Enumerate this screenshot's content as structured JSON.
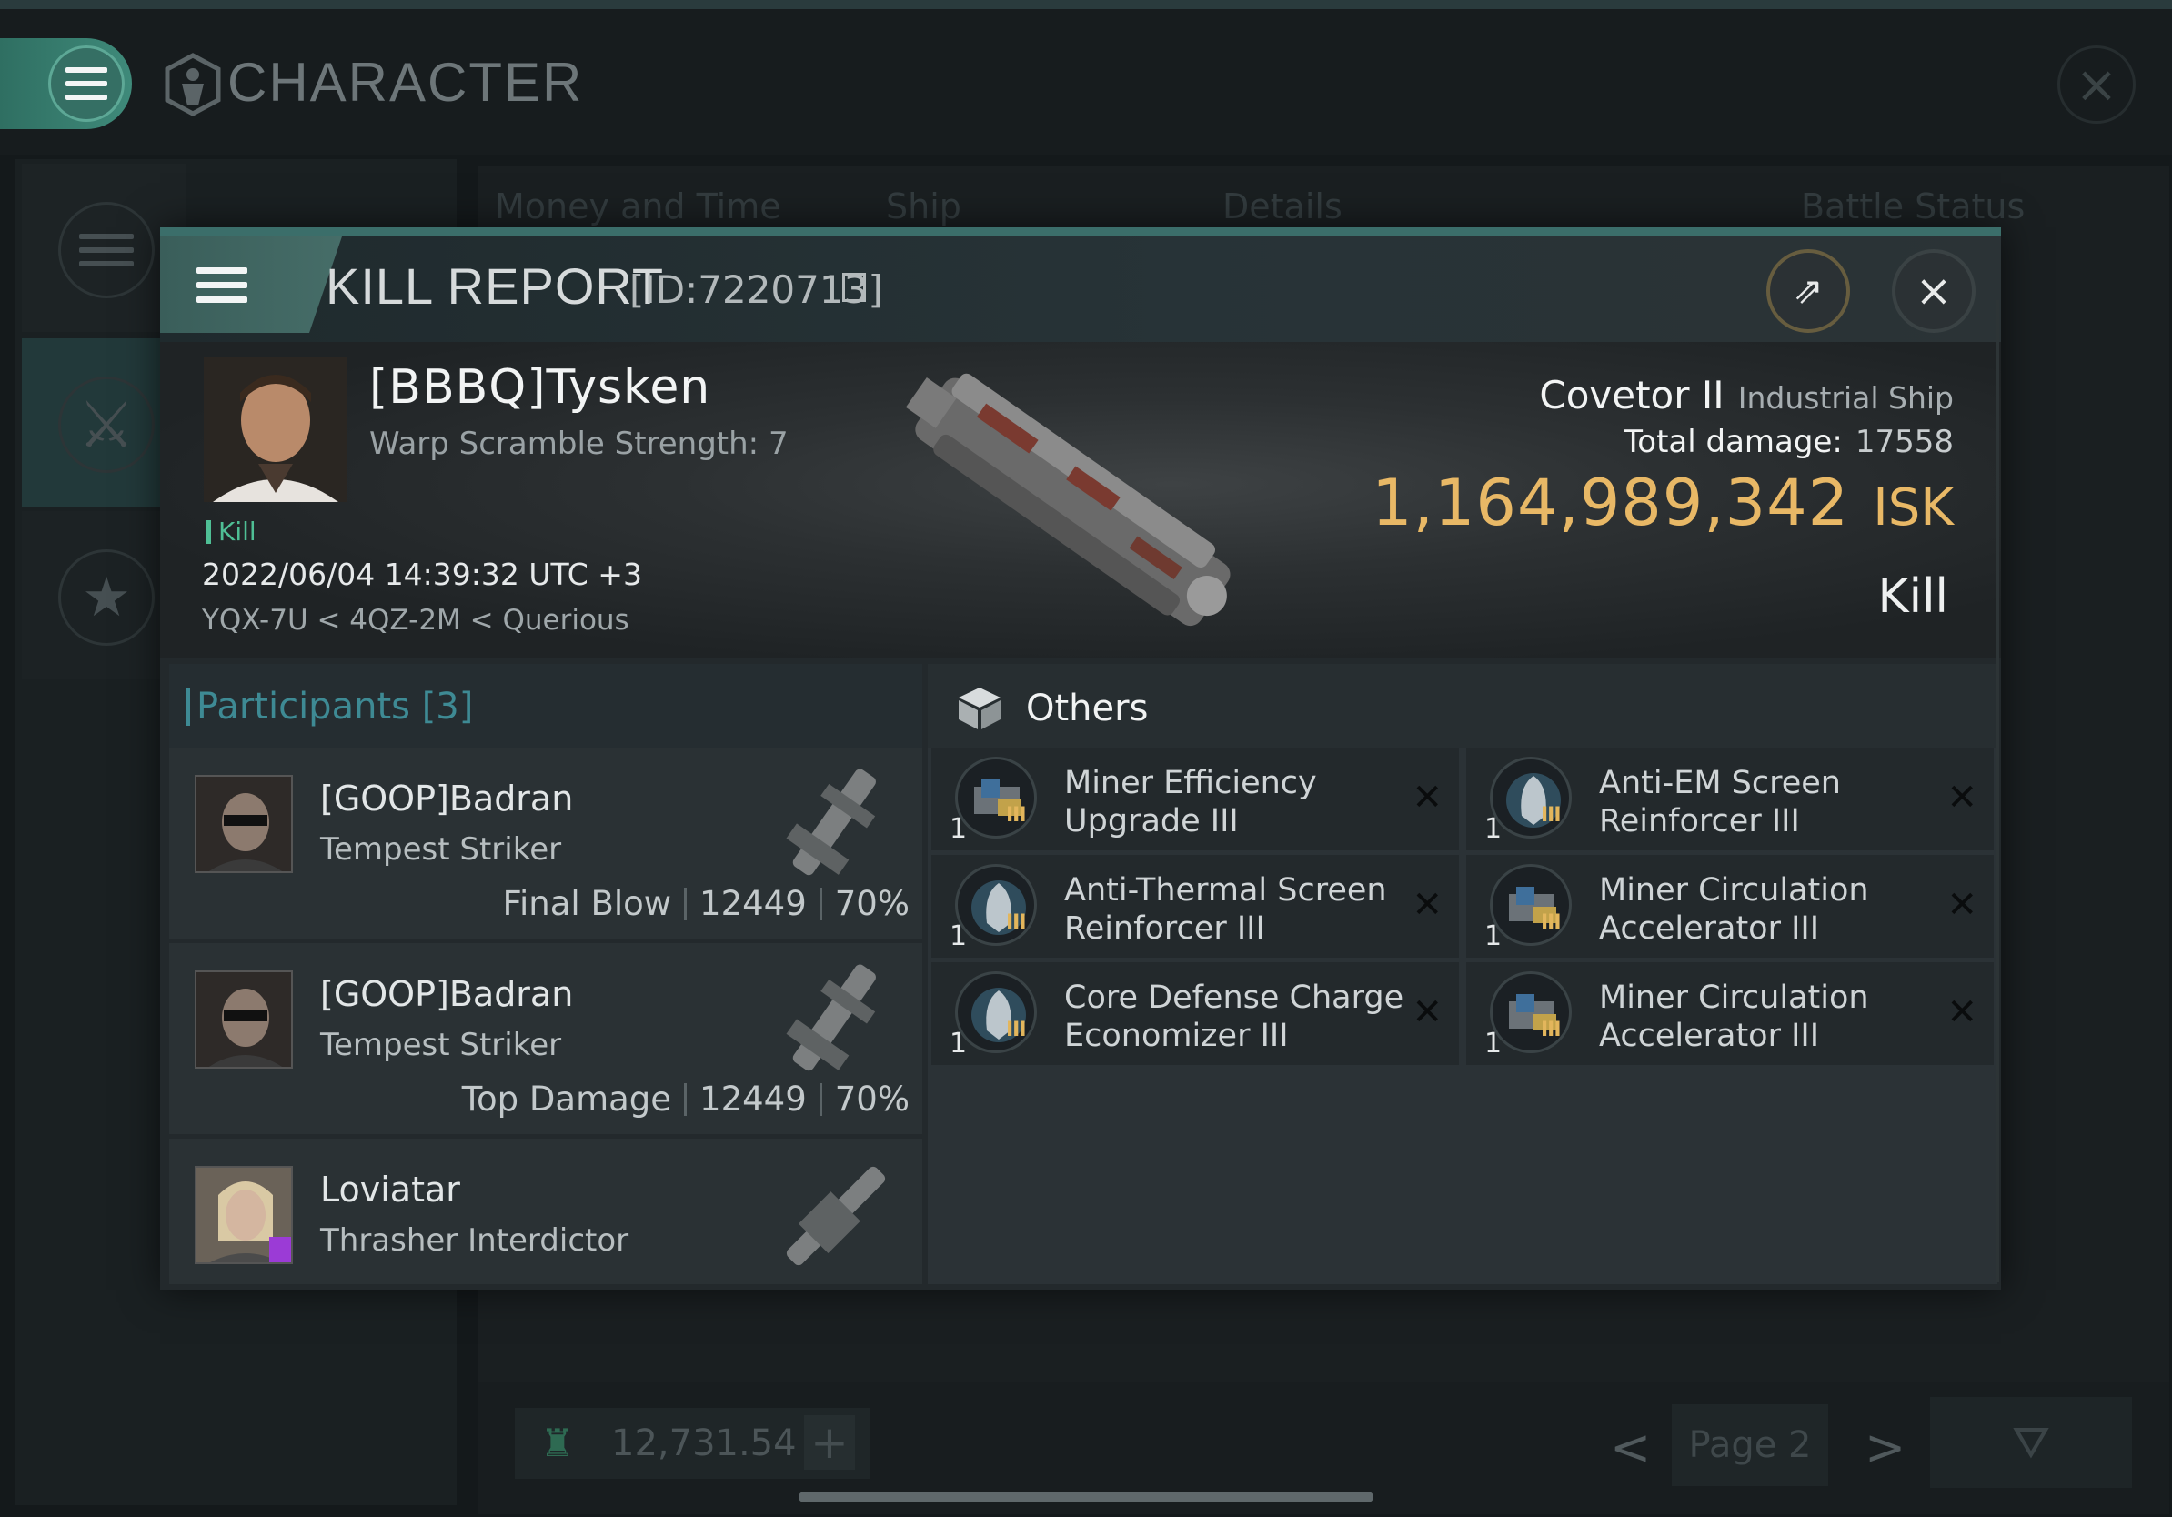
{
  "app": {
    "title": "CHARACTER"
  },
  "background": {
    "columns": [
      "Money and Time",
      "Ship",
      "Details",
      "Battle Status"
    ],
    "wallet_value": "12,731.54",
    "page_label": "Page 2"
  },
  "kill_report": {
    "title": "KILL REPORT",
    "id_text": "[ID:7220713]",
    "victim": {
      "name": "[BBBQ]Tysken",
      "warp_scramble": "Warp Scramble Strength: 7",
      "tag": "Kill",
      "datetime": "2022/06/04 14:39:32 UTC +3",
      "location": "YQX-7U < 4QZ-2M < Querious"
    },
    "ship": {
      "name": "Covetor II",
      "class": "Industrial Ship",
      "damage_label": "Total damage:",
      "damage_value": "17558",
      "isk_value": "1,164,989,342",
      "isk_unit": "ISK",
      "result": "Kill"
    },
    "participants": {
      "label": "Participants",
      "count": "[3]",
      "items": [
        {
          "name": "[GOOP]Badran",
          "ship": "Tempest Striker",
          "role": "Final Blow",
          "damage": "12449",
          "percent": "70%"
        },
        {
          "name": "[GOOP]Badran",
          "ship": "Tempest Striker",
          "role": "Top Damage",
          "damage": "12449",
          "percent": "70%"
        },
        {
          "name": "Loviatar",
          "ship": "Thrasher Interdictor"
        }
      ]
    },
    "others": {
      "label": "Others",
      "items": [
        {
          "qty": "1",
          "meta": "III",
          "name": "Miner Efficiency Upgrade III",
          "icon": "miner-module-icon"
        },
        {
          "qty": "1",
          "meta": "III",
          "name": "Anti-EM Screen Reinforcer III",
          "icon": "shield-rig-icon"
        },
        {
          "qty": "1",
          "meta": "III",
          "name": "Anti-Thermal Screen Reinforcer III",
          "icon": "shield-rig-icon"
        },
        {
          "qty": "1",
          "meta": "III",
          "name": "Miner Circulation Accelerator III",
          "icon": "miner-module-icon"
        },
        {
          "qty": "1",
          "meta": "III",
          "name": "Core Defense Charge Economizer III",
          "icon": "shield-rig-icon"
        },
        {
          "qty": "1",
          "meta": "III",
          "name": "Miner Circulation Accelerator III",
          "icon": "miner-module-icon"
        }
      ]
    }
  },
  "colors": {
    "accent": "#3e8a94",
    "isk": "#e8b866",
    "kill_green": "#4fbf95"
  }
}
